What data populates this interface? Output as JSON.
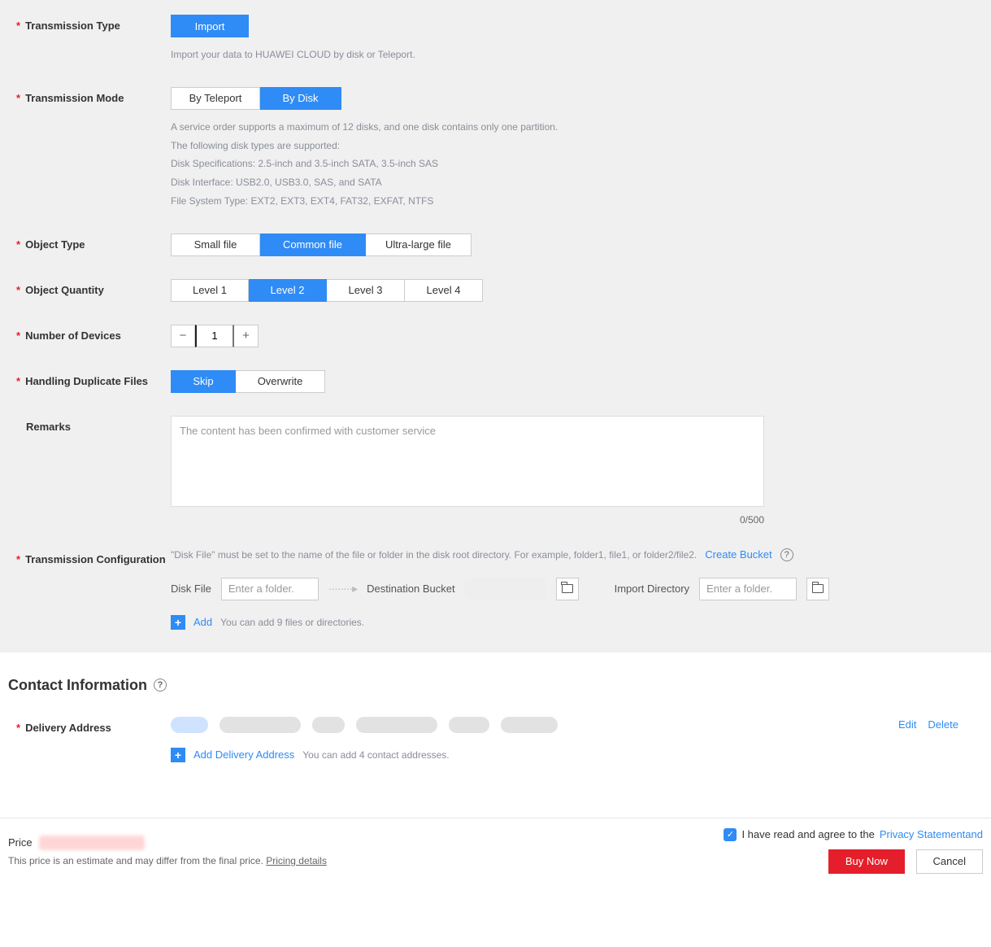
{
  "trans_type": {
    "label": "Transmission Type",
    "options": [
      "Import"
    ],
    "selected": 0,
    "hint": "Import your data to HUAWEI CLOUD by disk or Teleport."
  },
  "trans_mode": {
    "label": "Transmission Mode",
    "options": [
      "By Teleport",
      "By Disk"
    ],
    "selected": 1,
    "hints": [
      "A service order supports a maximum of 12 disks, and one disk contains only one partition.",
      "The following disk types are supported:",
      "Disk Specifications: 2.5-inch and 3.5-inch SATA, 3.5-inch SAS",
      "Disk Interface: USB2.0, USB3.0, SAS, and SATA",
      "File System Type: EXT2, EXT3, EXT4, FAT32, EXFAT, NTFS"
    ]
  },
  "obj_type": {
    "label": "Object Type",
    "options": [
      "Small file",
      "Common file",
      "Ultra-large file"
    ],
    "selected": 1
  },
  "obj_qty": {
    "label": "Object Quantity",
    "options": [
      "Level 1",
      "Level 2",
      "Level 3",
      "Level 4"
    ],
    "selected": 1
  },
  "devices": {
    "label": "Number of Devices",
    "value": "1"
  },
  "dup": {
    "label": "Handling Duplicate Files",
    "options": [
      "Skip",
      "Overwrite"
    ],
    "selected": 0
  },
  "remarks": {
    "label": "Remarks",
    "placeholder": "The content has been confirmed with customer service",
    "counter": "0/500"
  },
  "tconf": {
    "label": "Transmission Configuration",
    "desc": "\"Disk File\" must be set to the name of the file or folder in the disk root directory. For example, folder1, file1, or folder2/file2.",
    "create_bucket": "Create Bucket",
    "disk_file_label": "Disk File",
    "disk_file_ph": "Enter a folder.",
    "dest_label": "Destination Bucket",
    "import_label": "Import Directory",
    "import_ph": "Enter a folder.",
    "add": "Add",
    "add_hint": "You can add 9 files or directories."
  },
  "contact": {
    "title": "Contact Information",
    "delivery_label": "Delivery Address",
    "edit": "Edit",
    "delete": "Delete",
    "add": "Add Delivery Address",
    "add_hint": "You can add 4 contact addresses."
  },
  "bottom": {
    "price_label": "Price",
    "price_hint": "This price is an estimate and may differ from the final price. ",
    "pricing_details": "Pricing details",
    "agree_pre": "I have read and agree to the ",
    "agree_link": "Privacy Statementand",
    "buy": "Buy Now",
    "cancel": "Cancel"
  }
}
